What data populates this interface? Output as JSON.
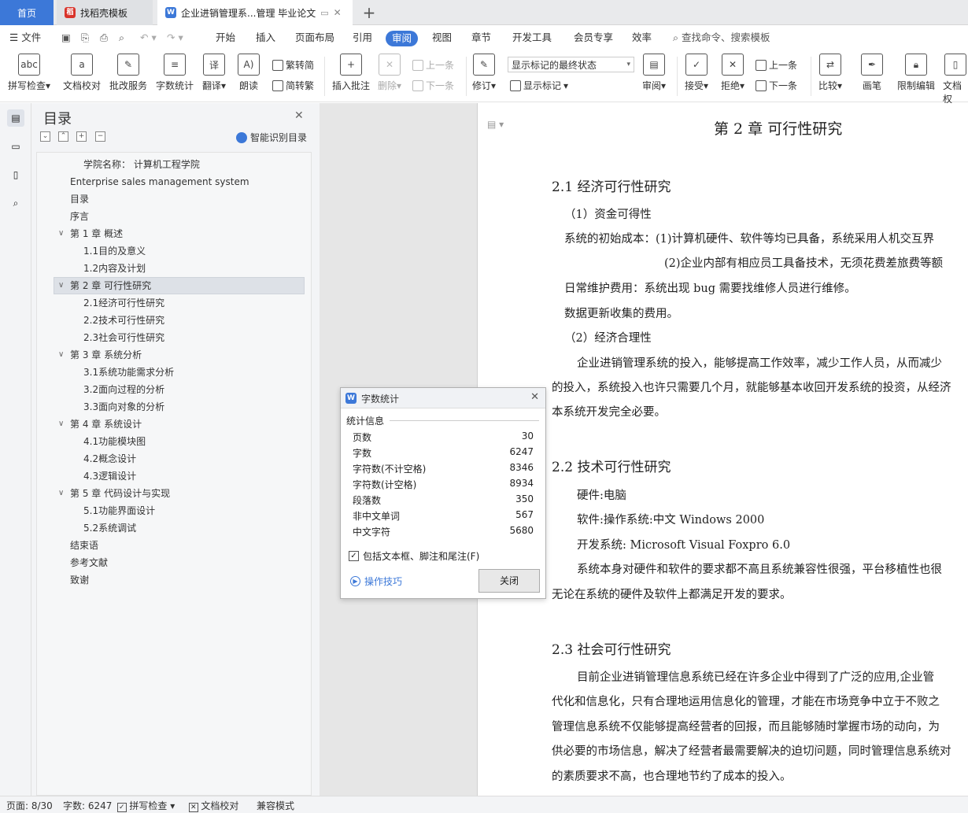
{
  "tabs": {
    "home": "首页",
    "template": "找稻壳模板",
    "document": "企业进销管理系...管理 毕业论文"
  },
  "menu": {
    "file": "文件",
    "items": [
      "开始",
      "插入",
      "页面布局",
      "引用",
      "审阅",
      "视图",
      "章节",
      "开发工具",
      "会员专享",
      "效率"
    ],
    "active": "审阅",
    "search": "查找命令、搜索模板"
  },
  "ribbon": {
    "spell": "拼写检查",
    "proofread": "文档校对",
    "batch": "批改服务",
    "wordcount": "字数统计",
    "translate": "翻译",
    "read": "朗读",
    "to_traditional": "繁转简",
    "to_simplified": "简转繁",
    "insert_comment": "插入批注",
    "delete": "删除",
    "prev": "上一条",
    "next": "下一条",
    "track": "修订",
    "markup_select": "显示标记的最终状态",
    "show_markup": "显示标记",
    "review": "审阅",
    "accept": "接受",
    "reject": "拒绝",
    "prev2": "上一条",
    "next2": "下一条",
    "compare": "比较",
    "pen": "画笔",
    "restrict": "限制编辑",
    "doc_perm": "文档权"
  },
  "toc": {
    "title": "目录",
    "smart": "智能识别目录",
    "items": [
      {
        "text": "学院名称：  计算机工程学院",
        "level": 2
      },
      {
        "text": "Enterprise sales management system",
        "level": 0
      },
      {
        "text": "目录",
        "level": 0
      },
      {
        "text": "序言",
        "level": 0
      },
      {
        "text": "第 1 章  概述",
        "level": 1
      },
      {
        "text": "1.1目的及意义",
        "level": 2
      },
      {
        "text": "1.2内容及计划",
        "level": 2
      },
      {
        "text": "第 2 章  可行性研究",
        "level": 1
      },
      {
        "text": "2.1经济可行性研究",
        "level": 2
      },
      {
        "text": "2.2技术可行性研究",
        "level": 2
      },
      {
        "text": "2.3社会可行性研究",
        "level": 2
      },
      {
        "text": "第 3 章  系统分析",
        "level": 1
      },
      {
        "text": "3.1系统功能需求分析",
        "level": 2
      },
      {
        "text": "3.2面向过程的分析",
        "level": 2
      },
      {
        "text": "3.3面向对象的分析",
        "level": 2
      },
      {
        "text": "第 4 章  系统设计",
        "level": 1
      },
      {
        "text": "4.1功能模块图",
        "level": 2
      },
      {
        "text": "4.2概念设计",
        "level": 2
      },
      {
        "text": "4.3逻辑设计",
        "level": 2
      },
      {
        "text": "第 5 章  代码设计与实现",
        "level": 1
      },
      {
        "text": "5.1功能界面设计",
        "level": 2
      },
      {
        "text": "5.2系统调试",
        "level": 2
      },
      {
        "text": "结束语",
        "level": 0
      },
      {
        "text": "参考文献",
        "level": 0
      },
      {
        "text": "致谢",
        "level": 0
      }
    ],
    "selected": "第 2 章  可行性研究"
  },
  "doc": {
    "chapter": "第 2 章   可行性研究",
    "s21": "2.1   经济可行性研究",
    "p1": "（1）资金可得性",
    "p2": "系统的初始成本：(1)计算机硬件、软件等均已具备，系统采用人机交互界",
    "p3": "(2)企业内部有相应员工具备技术，无须花费差旅费等额",
    "p4": "日常维护费用：系统出现 bug 需要找维修人员进行维修。",
    "p5": "数据更新收集的费用。",
    "p6": "（2）经济合理性",
    "p7": "企业进销管理系统的投入，能够提高工作效率，减少工作人员，从而减少",
    "p8": "的投入，系统投入也许只需要几个月，就能够基本收回开发系统的投资，从经济",
    "p9": "本系统开发完全必要。",
    "s22": "2.2   技术可行性研究",
    "q1": "硬件:电脑",
    "q2": "软件:操作系统:中文 Windows 2000",
    "q3": "开发系统: Microsoft Visual Foxpro 6.0",
    "q4": "系统本身对硬件和软件的要求都不高且系统兼容性很强，平台移植性也很",
    "q5": "无论在系统的硬件及软件上都满足开发的要求。",
    "s23": "2.3   社会可行性研究",
    "r1": "目前企业进销管理信息系统已经在许多企业中得到了广泛的应用,企业管",
    "r2": "代化和信息化，只有合理地运用信息化的管理，才能在市场竞争中立于不败之",
    "r3": "管理信息系统不仅能够提高经营者的回报，而且能够随时掌握市场的动向，为",
    "r4": "供必要的市场信息，解决了经营者最需要解决的迫切问题，同时管理信息系统对",
    "r5": "的素质要求不高，也合理地节约了成本的投入。"
  },
  "dialog": {
    "title": "字数统计",
    "section": "统计信息",
    "rows": [
      {
        "label": "页数",
        "value": "30"
      },
      {
        "label": "字数",
        "value": "6247"
      },
      {
        "label": "字符数(不计空格)",
        "value": "8346"
      },
      {
        "label": "字符数(计空格)",
        "value": "8934"
      },
      {
        "label": "段落数",
        "value": "350"
      },
      {
        "label": "非中文单词",
        "value": "567"
      },
      {
        "label": "中文字符",
        "value": "5680"
      }
    ],
    "checkbox": "包括文本框、脚注和尾注(F)",
    "tips": "操作技巧",
    "close": "关闭"
  },
  "status": {
    "page": "页面: 8/30",
    "words": "字数: 6247",
    "spell": "拼写检查",
    "proof": "文档校对",
    "compat": "兼容模式"
  },
  "colors": {
    "accent": "#3c78d8",
    "wps_red": "#d9342b"
  }
}
